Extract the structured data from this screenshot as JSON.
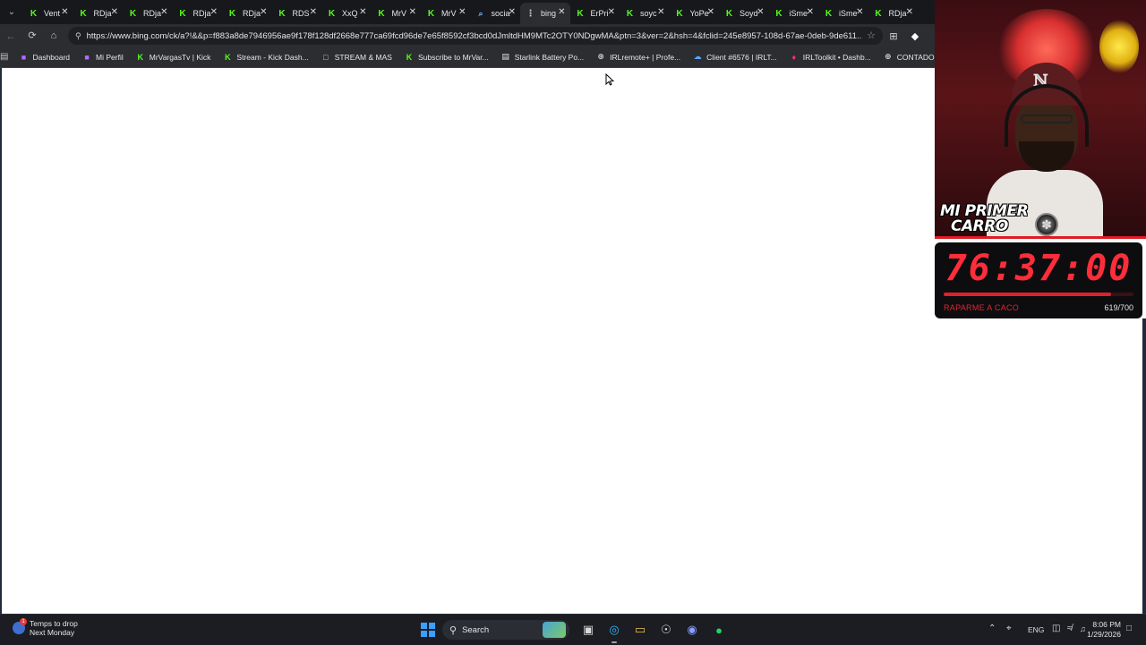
{
  "browser": {
    "tabs": [
      {
        "label": "Vent",
        "icon": "kick-icon",
        "active": false
      },
      {
        "label": "RDja",
        "icon": "kick-icon",
        "active": false
      },
      {
        "label": "RDja",
        "icon": "kick-icon",
        "active": false
      },
      {
        "label": "RDja",
        "icon": "kick-icon",
        "active": false
      },
      {
        "label": "RDja",
        "icon": "kick-icon",
        "active": false
      },
      {
        "label": "RDS",
        "icon": "kick-icon",
        "active": false
      },
      {
        "label": "XxQ",
        "icon": "kick-icon",
        "active": false
      },
      {
        "label": "MrV",
        "icon": "kick-icon",
        "active": false
      },
      {
        "label": "MrV",
        "icon": "kick-icon",
        "active": false
      },
      {
        "label": "socia",
        "icon": "search-icon",
        "active": false
      },
      {
        "label": "bing",
        "icon": "loading-icon",
        "active": true
      },
      {
        "label": "ErPri",
        "icon": "kick-icon",
        "active": false
      },
      {
        "label": "soyc",
        "icon": "kick-icon",
        "active": false
      },
      {
        "label": "YoPe",
        "icon": "kick-icon",
        "active": false
      },
      {
        "label": "Soyd",
        "icon": "kick-icon",
        "active": false
      },
      {
        "label": "iSme",
        "icon": "kick-icon",
        "active": false
      },
      {
        "label": "iSme",
        "icon": "kick-icon",
        "active": false
      },
      {
        "label": "RDja",
        "icon": "kick-icon",
        "active": false
      }
    ],
    "url": "https://www.bing.com/ck/a?!&&p=f883a8de7946956ae9f178f128df2668e777ca69fcd96de7e65f8592cf3bcd0dJmltdHM9MTc2OTY0NDgwMA&ptn=3&ver=2&hsh=4&fclid=245e8957-108d-67ae-0deb-9de611...",
    "bookmarks": [
      {
        "label": "Dashboard",
        "icon": "twitch-icon"
      },
      {
        "label": "Mi Perfil",
        "icon": "twitch-icon"
      },
      {
        "label": "MrVargasTv | Kick",
        "icon": "kick-icon"
      },
      {
        "label": "Stream - Kick Dash...",
        "icon": "kick-icon"
      },
      {
        "label": "STREAM & MAS",
        "icon": "folder-icon"
      },
      {
        "label": "Subscribe to MrVar...",
        "icon": "kick-icon"
      },
      {
        "label": "Starlink Battery Po...",
        "icon": "card-icon"
      },
      {
        "label": "IRLremote+ | Profe...",
        "icon": "globe-icon"
      },
      {
        "label": "Client #6576 | IRLT...",
        "icon": "cloud-icon"
      },
      {
        "label": "IRLToolkit • Dashb...",
        "icon": "irltoolkit-icon"
      },
      {
        "label": "CONTADOR",
        "icon": "globe-icon"
      }
    ]
  },
  "stream_overlay": {
    "title_line1": "MI PRIMER",
    "title_line2": "CARRO",
    "timer": "76:37:00",
    "goal_label": "RAPARME A CACO",
    "goal_count": "619/700",
    "goal_progress": 0.884,
    "accent_color": "#ff2d3a"
  },
  "taskbar": {
    "weather_title": "Temps to drop",
    "weather_sub": "Next Monday",
    "weather_badge": "1",
    "search_label": "Search",
    "language": "ENG",
    "time": "8:06 PM",
    "date": "1/29/2026"
  }
}
